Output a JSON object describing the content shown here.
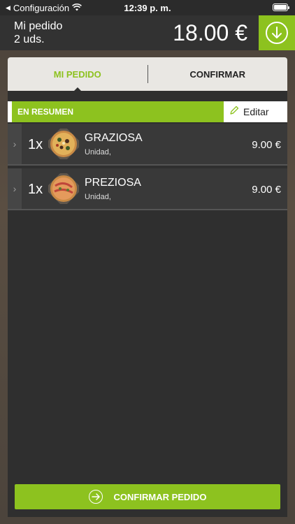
{
  "status_bar": {
    "back_label": "Configuración",
    "time": "12:39 p. m."
  },
  "header": {
    "order_title": "Mi pedido",
    "units": "2 uds.",
    "total": "18.00 €",
    "download_icon": "arrow-down-circle-icon"
  },
  "tabs": [
    {
      "label": "MI PEDIDO",
      "active": true
    },
    {
      "label": "CONFIRMAR",
      "active": false
    }
  ],
  "summary": {
    "label": "EN RESUMEN",
    "edit_label": "Editar"
  },
  "items": [
    {
      "qty": "1x",
      "name": "GRAZIOSA",
      "sub": "Unidad,",
      "price": "9.00 €"
    },
    {
      "qty": "1x",
      "name": "PREZIOSA",
      "sub": "Unidad,",
      "price": "9.00 €"
    }
  ],
  "confirm": {
    "label": "CONFIRMAR PEDIDO"
  },
  "colors": {
    "accent": "#8dc21f",
    "header_bg": "#323232",
    "panel_bg": "#2f2f2f"
  }
}
